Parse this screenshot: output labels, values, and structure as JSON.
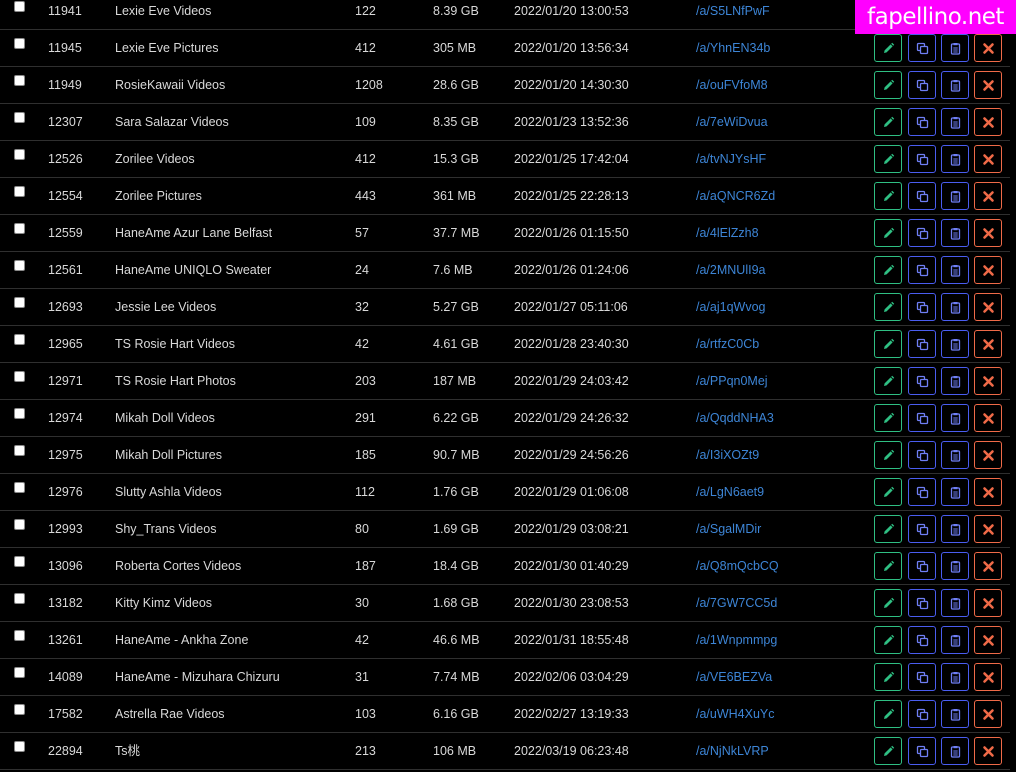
{
  "watermark": "fapellino.net",
  "colors": {
    "background": "#000000",
    "text": "#d9d9d9",
    "link": "#3d85d6",
    "edit_border": "#2fbf83",
    "copy_border": "#4a5df0",
    "delete_border": "#ef6a48",
    "watermark_bg": "#ff00ff"
  },
  "action_icons": [
    "pencil-icon",
    "copy-icon",
    "clipboard-icon",
    "close-icon"
  ],
  "rows": [
    {
      "id": "11941",
      "title": "Lexie Eve Videos",
      "count": "122",
      "size": "8.39 GB",
      "date": "2022/01/20 13:00:53",
      "link": "/a/S5LNfPwF"
    },
    {
      "id": "11945",
      "title": "Lexie Eve Pictures",
      "count": "412",
      "size": "305 MB",
      "date": "2022/01/20 13:56:34",
      "link": "/a/YhnEN34b"
    },
    {
      "id": "11949",
      "title": "RosieKawaii Videos",
      "count": "1208",
      "size": "28.6 GB",
      "date": "2022/01/20 14:30:30",
      "link": "/a/ouFVfoM8"
    },
    {
      "id": "12307",
      "title": "Sara Salazar Videos",
      "count": "109",
      "size": "8.35 GB",
      "date": "2022/01/23 13:52:36",
      "link": "/a/7eWiDvua"
    },
    {
      "id": "12526",
      "title": "Zorilee Videos",
      "count": "412",
      "size": "15.3 GB",
      "date": "2022/01/25 17:42:04",
      "link": "/a/tvNJYsHF"
    },
    {
      "id": "12554",
      "title": "Zorilee Pictures",
      "count": "443",
      "size": "361 MB",
      "date": "2022/01/25 22:28:13",
      "link": "/a/aQNCR6Zd"
    },
    {
      "id": "12559",
      "title": "HaneAme Azur Lane Belfast",
      "count": "57",
      "size": "37.7 MB",
      "date": "2022/01/26 01:15:50",
      "link": "/a/4lElZzh8"
    },
    {
      "id": "12561",
      "title": "HaneAme UNIQLO Sweater",
      "count": "24",
      "size": "7.6 MB",
      "date": "2022/01/26 01:24:06",
      "link": "/a/2MNUlI9a"
    },
    {
      "id": "12693",
      "title": "Jessie Lee Videos",
      "count": "32",
      "size": "5.27 GB",
      "date": "2022/01/27 05:11:06",
      "link": "/a/aj1qWvog"
    },
    {
      "id": "12965",
      "title": "TS Rosie Hart Videos",
      "count": "42",
      "size": "4.61 GB",
      "date": "2022/01/28 23:40:30",
      "link": "/a/rtfzC0Cb"
    },
    {
      "id": "12971",
      "title": "TS Rosie Hart Photos",
      "count": "203",
      "size": "187 MB",
      "date": "2022/01/29 24:03:42",
      "link": "/a/PPqn0Mej"
    },
    {
      "id": "12974",
      "title": "Mikah Doll Videos",
      "count": "291",
      "size": "6.22 GB",
      "date": "2022/01/29 24:26:32",
      "link": "/a/QqddNHA3"
    },
    {
      "id": "12975",
      "title": "Mikah Doll Pictures",
      "count": "185",
      "size": "90.7 MB",
      "date": "2022/01/29 24:56:26",
      "link": "/a/I3iXOZt9"
    },
    {
      "id": "12976",
      "title": "Slutty Ashla Videos",
      "count": "112",
      "size": "1.76 GB",
      "date": "2022/01/29 01:06:08",
      "link": "/a/LgN6aet9"
    },
    {
      "id": "12993",
      "title": "Shy_Trans Videos",
      "count": "80",
      "size": "1.69 GB",
      "date": "2022/01/29 03:08:21",
      "link": "/a/SgalMDir"
    },
    {
      "id": "13096",
      "title": "Roberta Cortes Videos",
      "count": "187",
      "size": "18.4 GB",
      "date": "2022/01/30 01:40:29",
      "link": "/a/Q8mQcbCQ"
    },
    {
      "id": "13182",
      "title": "Kitty Kimz Videos",
      "count": "30",
      "size": "1.68 GB",
      "date": "2022/01/30 23:08:53",
      "link": "/a/7GW7CC5d"
    },
    {
      "id": "13261",
      "title": "HaneAme - Ankha Zone",
      "count": "42",
      "size": "46.6 MB",
      "date": "2022/01/31 18:55:48",
      "link": "/a/1Wnpmmpg"
    },
    {
      "id": "14089",
      "title": "HaneAme - Mizuhara Chizuru",
      "count": "31",
      "size": "7.74 MB",
      "date": "2022/02/06 03:04:29",
      "link": "/a/VE6BEZVa"
    },
    {
      "id": "17582",
      "title": "Astrella Rae Videos",
      "count": "103",
      "size": "6.16 GB",
      "date": "2022/02/27 13:19:33",
      "link": "/a/uWH4XuYc"
    },
    {
      "id": "22894",
      "title": "Ts桃",
      "count": "213",
      "size": "106 MB",
      "date": "2022/03/19 06:23:48",
      "link": "/a/NjNkLVRP"
    }
  ]
}
